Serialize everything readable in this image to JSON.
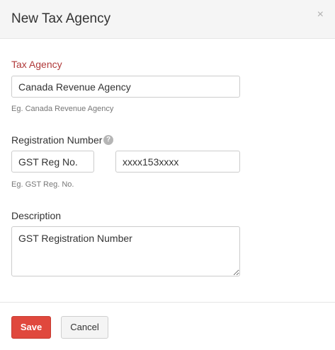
{
  "modal": {
    "title": "New Tax Agency",
    "close_glyph": "×"
  },
  "form": {
    "tax_agency": {
      "label": "Tax Agency",
      "value": "Canada Revenue Agency",
      "hint": "Eg. Canada Revenue Agency"
    },
    "registration": {
      "label": "Registration Number",
      "help_glyph": "?",
      "name_value": "GST Reg No.",
      "number_value": "xxxx153xxxx",
      "hint": "Eg. GST Reg. No."
    },
    "description": {
      "label": "Description",
      "value": "GST Registration Number"
    }
  },
  "footer": {
    "save_label": "Save",
    "cancel_label": "Cancel"
  },
  "colors": {
    "accent": "#e0483d",
    "required_label": "#b03a3a"
  }
}
